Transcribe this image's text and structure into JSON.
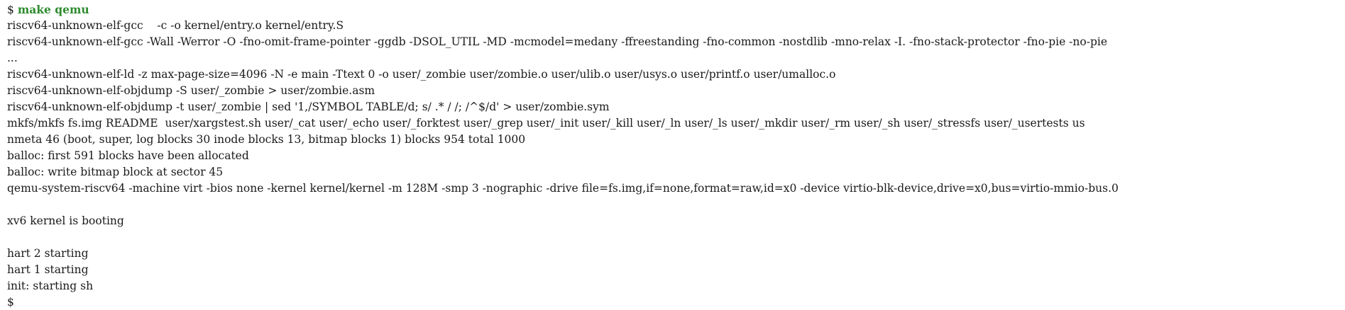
{
  "terminal": {
    "command_prompt": "$",
    "command": "make qemu",
    "output_lines": [
      "riscv64-unknown-elf-gcc    -c -o kernel/entry.o kernel/entry.S",
      "riscv64-unknown-elf-gcc -Wall -Werror -O -fno-omit-frame-pointer -ggdb -DSOL_UTIL -MD -mcmodel=medany -ffreestanding -fno-common -nostdlib -mno-relax -I. -fno-stack-protector -fno-pie -no-pie",
      "...",
      "riscv64-unknown-elf-ld -z max-page-size=4096 -N -e main -Ttext 0 -o user/_zombie user/zombie.o user/ulib.o user/usys.o user/printf.o user/umalloc.o",
      "riscv64-unknown-elf-objdump -S user/_zombie > user/zombie.asm",
      "riscv64-unknown-elf-objdump -t user/_zombie | sed '1,/SYMBOL TABLE/d; s/ .* / /; /^$/d' > user/zombie.sym",
      "mkfs/mkfs fs.img README  user/xargstest.sh user/_cat user/_echo user/_forktest user/_grep user/_init user/_kill user/_ln user/_ls user/_mkdir user/_rm user/_sh user/_stressfs user/_usertests us",
      "nmeta 46 (boot, super, log blocks 30 inode blocks 13, bitmap blocks 1) blocks 954 total 1000",
      "balloc: first 591 blocks have been allocated",
      "balloc: write bitmap block at sector 45",
      "qemu-system-riscv64 -machine virt -bios none -kernel kernel/kernel -m 128M -smp 3 -nographic -drive file=fs.img,if=none,format=raw,id=x0 -device virtio-blk-device,drive=x0,bus=virtio-mmio-bus.0",
      "",
      "xv6 kernel is booting",
      "",
      "hart 2 starting",
      "hart 1 starting",
      "init: starting sh"
    ],
    "final_prompt": "$"
  }
}
